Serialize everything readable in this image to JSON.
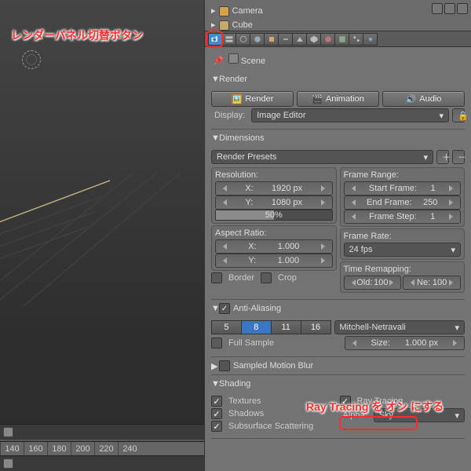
{
  "outliner": {
    "items": [
      "Camera",
      "Cube"
    ]
  },
  "tabs": [
    "render",
    "layers",
    "scene",
    "world",
    "object",
    "constraints",
    "modifiers",
    "data",
    "material",
    "texture",
    "particles",
    "physics"
  ],
  "active_tab": "render",
  "crumb": {
    "scene": "Scene"
  },
  "render": {
    "title": "Render",
    "buttons": {
      "render": "Render",
      "animation": "Animation",
      "audio": "Audio"
    },
    "display_label": "Display:",
    "display_value": "Image Editor"
  },
  "dimensions": {
    "title": "Dimensions",
    "presets": "Render Presets",
    "resolution": {
      "title": "Resolution:",
      "x_label": "X:",
      "x": "1920 px",
      "y_label": "Y:",
      "y": "1080 px",
      "pct": "50%"
    },
    "aspect": {
      "title": "Aspect Ratio:",
      "x_label": "X:",
      "x": "1.000",
      "y_label": "Y:",
      "y": "1.000"
    },
    "border": "Border",
    "crop": "Crop",
    "frame_range": {
      "title": "Frame Range:",
      "start_l": "Start Frame:",
      "start_v": "1",
      "end_l": "End Frame:",
      "end_v": "250",
      "step_l": "Frame Step:",
      "step_v": "1"
    },
    "frame_rate": {
      "title": "Frame Rate:",
      "value": "24 fps"
    },
    "remap": {
      "title": "Time Remapping:",
      "old_l": "Old:",
      "old_v": "100",
      "new_l": "Ne:",
      "new_v": "100"
    }
  },
  "aa": {
    "title": "Anti-Aliasing",
    "levels": [
      "5",
      "8",
      "11",
      "16"
    ],
    "active": "8",
    "filter": "Mitchell-Netravali",
    "full_sample": "Full Sample",
    "size_l": "Size:",
    "size_v": "1.000 px"
  },
  "motion_blur": {
    "title": "Sampled Motion Blur"
  },
  "shading": {
    "title": "Shading",
    "textures": "Textures",
    "shadows": "Shadows",
    "sss": "Subsurface Scattering",
    "raytracing": "Ray Tracing",
    "alpha_l": "Alpha:",
    "alpha_v": "Sky"
  },
  "timeline": {
    "ticks": [
      "140",
      "160",
      "180",
      "200",
      "220",
      "240"
    ]
  },
  "annot": {
    "a1": "レンダーパネル切替ボタン",
    "a2": "Ray Tracing を オン にする"
  },
  "chart_data": null
}
